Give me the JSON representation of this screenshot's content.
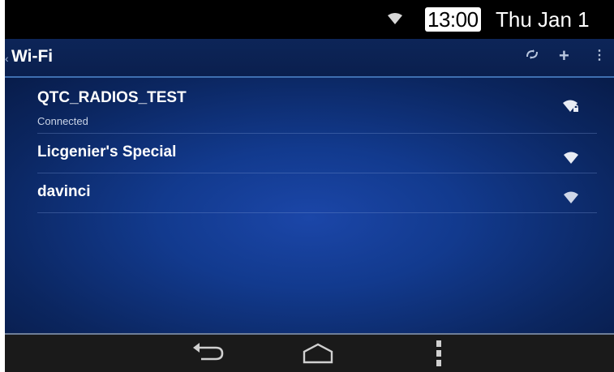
{
  "status_bar": {
    "time": "13:00",
    "date": "Thu Jan 1",
    "wifi_icon": "wifi-icon"
  },
  "action_bar": {
    "title": "Wi-Fi",
    "actions": [
      "wps-icon",
      "add-icon",
      "overflow-menu-icon"
    ]
  },
  "networks": [
    {
      "ssid": "QTC_RADIOS_TEST",
      "status": "Connected",
      "icon": "wifi-signal-locked-icon"
    },
    {
      "ssid": "Licgenier's Special",
      "status": "",
      "icon": "wifi-signal-icon"
    },
    {
      "ssid": "davinci",
      "status": "",
      "icon": "wifi-signal-icon"
    }
  ],
  "nav_bar": [
    "back-icon",
    "home-icon",
    "menu-icon"
  ],
  "colors": {
    "action_bar": "#0d2558",
    "accent_line": "#3e6fb0",
    "content_center": "#1b46a8",
    "content_edge": "#081c4a"
  }
}
